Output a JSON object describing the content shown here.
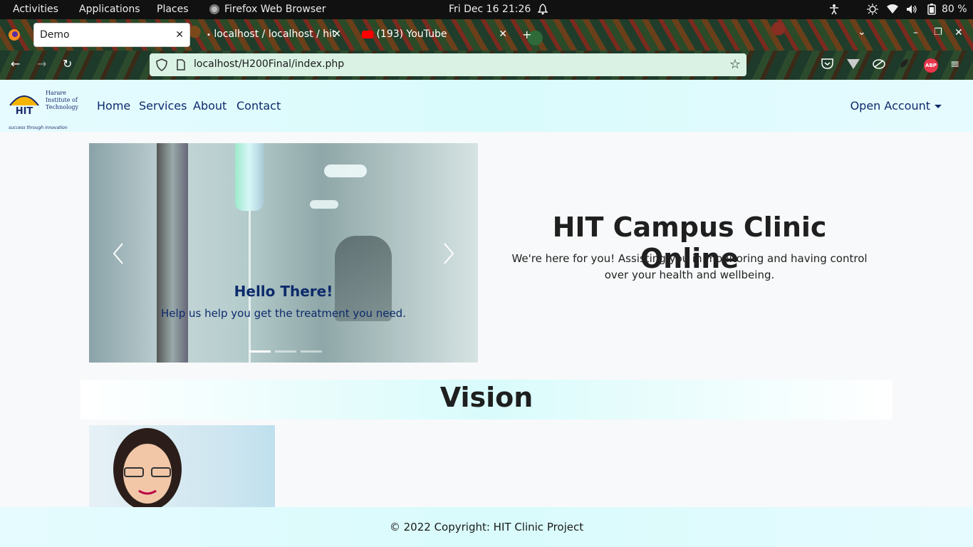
{
  "system_bar": {
    "activities": "Activities",
    "applications": "Applications",
    "places": "Places",
    "app_name": "Firefox Web Browser",
    "clock": "Fri Dec 16  21:26",
    "battery": "80 %"
  },
  "browser": {
    "tabs": [
      {
        "title": "Demo"
      },
      {
        "title": "localhost / localhost / hit"
      },
      {
        "title": "(193) YouTube"
      }
    ],
    "url": "localhost/H200Final/index.php"
  },
  "site": {
    "logo": {
      "line1": "Harare",
      "line2": "Institute of",
      "line3": "Technology",
      "mark": "HIT",
      "tagline": "success through innovation"
    },
    "nav": [
      "Home",
      "Services",
      "About",
      "Contact"
    ],
    "account_menu": "Open Account",
    "carousel": {
      "title": "Hello There!",
      "text": "Help us help you get the treatment you need.",
      "slides": 3,
      "active_slide": 1
    },
    "hero": {
      "title": "HIT Campus Clinic Online",
      "subtitle": "We're here for you! Assisting you in monitoring and having control over your health and wellbeing."
    },
    "vision_heading": "Vision",
    "footer": "© 2022 Copyright: HIT Clinic Project"
  }
}
